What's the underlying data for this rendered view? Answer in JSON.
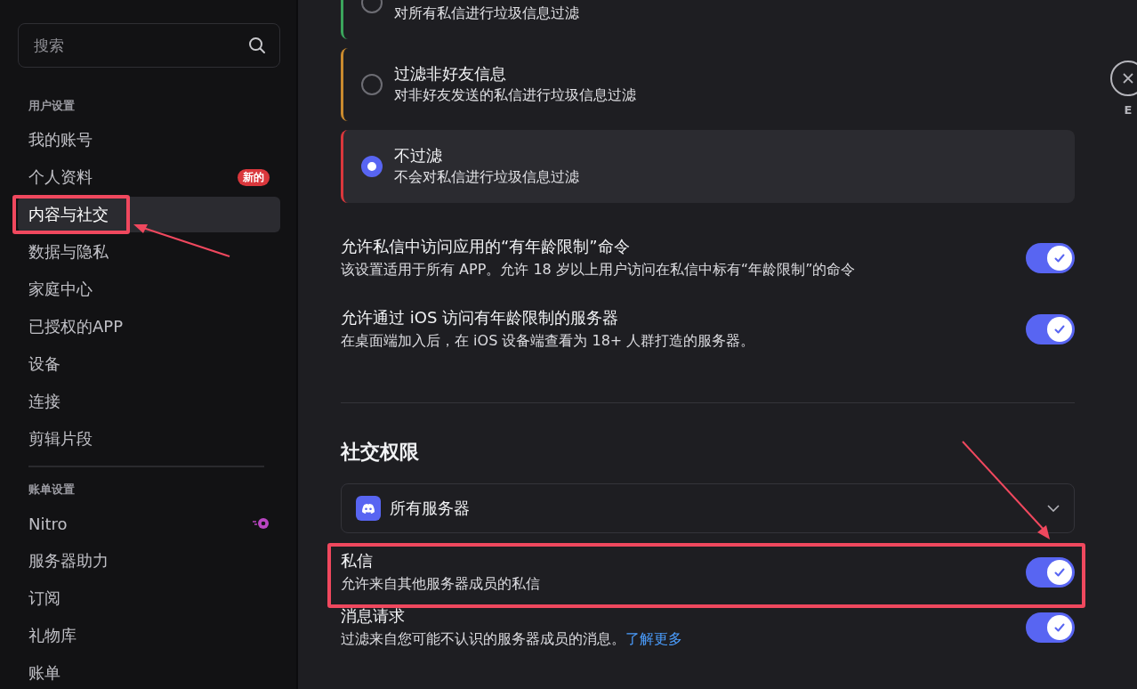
{
  "sidebar": {
    "search": {
      "placeholder": "搜索"
    },
    "sections": [
      {
        "header": "用户设置",
        "items": [
          {
            "label": "我的账号",
            "selected": false
          },
          {
            "label": "个人资料",
            "selected": false,
            "badge": "新的"
          },
          {
            "label": "内容与社交",
            "selected": true
          },
          {
            "label": "数据与隐私",
            "selected": false
          },
          {
            "label": "家庭中心",
            "selected": false
          },
          {
            "label": "已授权的APP",
            "selected": false
          },
          {
            "label": "设备",
            "selected": false
          },
          {
            "label": "连接",
            "selected": false
          },
          {
            "label": "剪辑片段",
            "selected": false
          }
        ]
      },
      {
        "header": "账单设置",
        "items": [
          {
            "label": "Nitro",
            "selected": false,
            "kind": "nitro"
          },
          {
            "label": "服务器助力",
            "selected": false
          },
          {
            "label": "订阅",
            "selected": false
          },
          {
            "label": "礼物库",
            "selected": false
          },
          {
            "label": "账单",
            "selected": false
          }
        ]
      }
    ]
  },
  "spam_filter": {
    "options": [
      {
        "description": "对所有私信进行垃圾信息过滤",
        "selected": false,
        "color": "#3ba55c"
      },
      {
        "title": "过滤非好友信息",
        "description": "对非好友发送的私信进行垃圾信息过滤",
        "selected": false,
        "color": "#c98a2e"
      },
      {
        "title": "不过滤",
        "description": "不会对私信进行垃圾信息过滤",
        "selected": true,
        "color": "#da373c"
      }
    ]
  },
  "age_settings": [
    {
      "title": "允许私信中访问应用的“有年龄限制”命令",
      "description": "该设置适用于所有 APP。允许 18 岁以上用户访问在私信中标有“年龄限制”的命令",
      "on": true
    },
    {
      "title": "允许通过 iOS 访问有年龄限制的服务器",
      "description": "在桌面端加入后，在 iOS 设备端查看为 18+ 人群打造的服务器。",
      "on": true
    }
  ],
  "social": {
    "heading": "社交权限",
    "dropdown": "所有服务器",
    "settings": [
      {
        "title": "私信",
        "description": "允许来自其他服务器成员的私信",
        "on": true
      },
      {
        "title": "消息请求",
        "description": "过滤来自您可能不认识的服务器成员的消息。",
        "link": "了解更多",
        "on": true
      }
    ]
  },
  "close": {
    "label": "E"
  }
}
